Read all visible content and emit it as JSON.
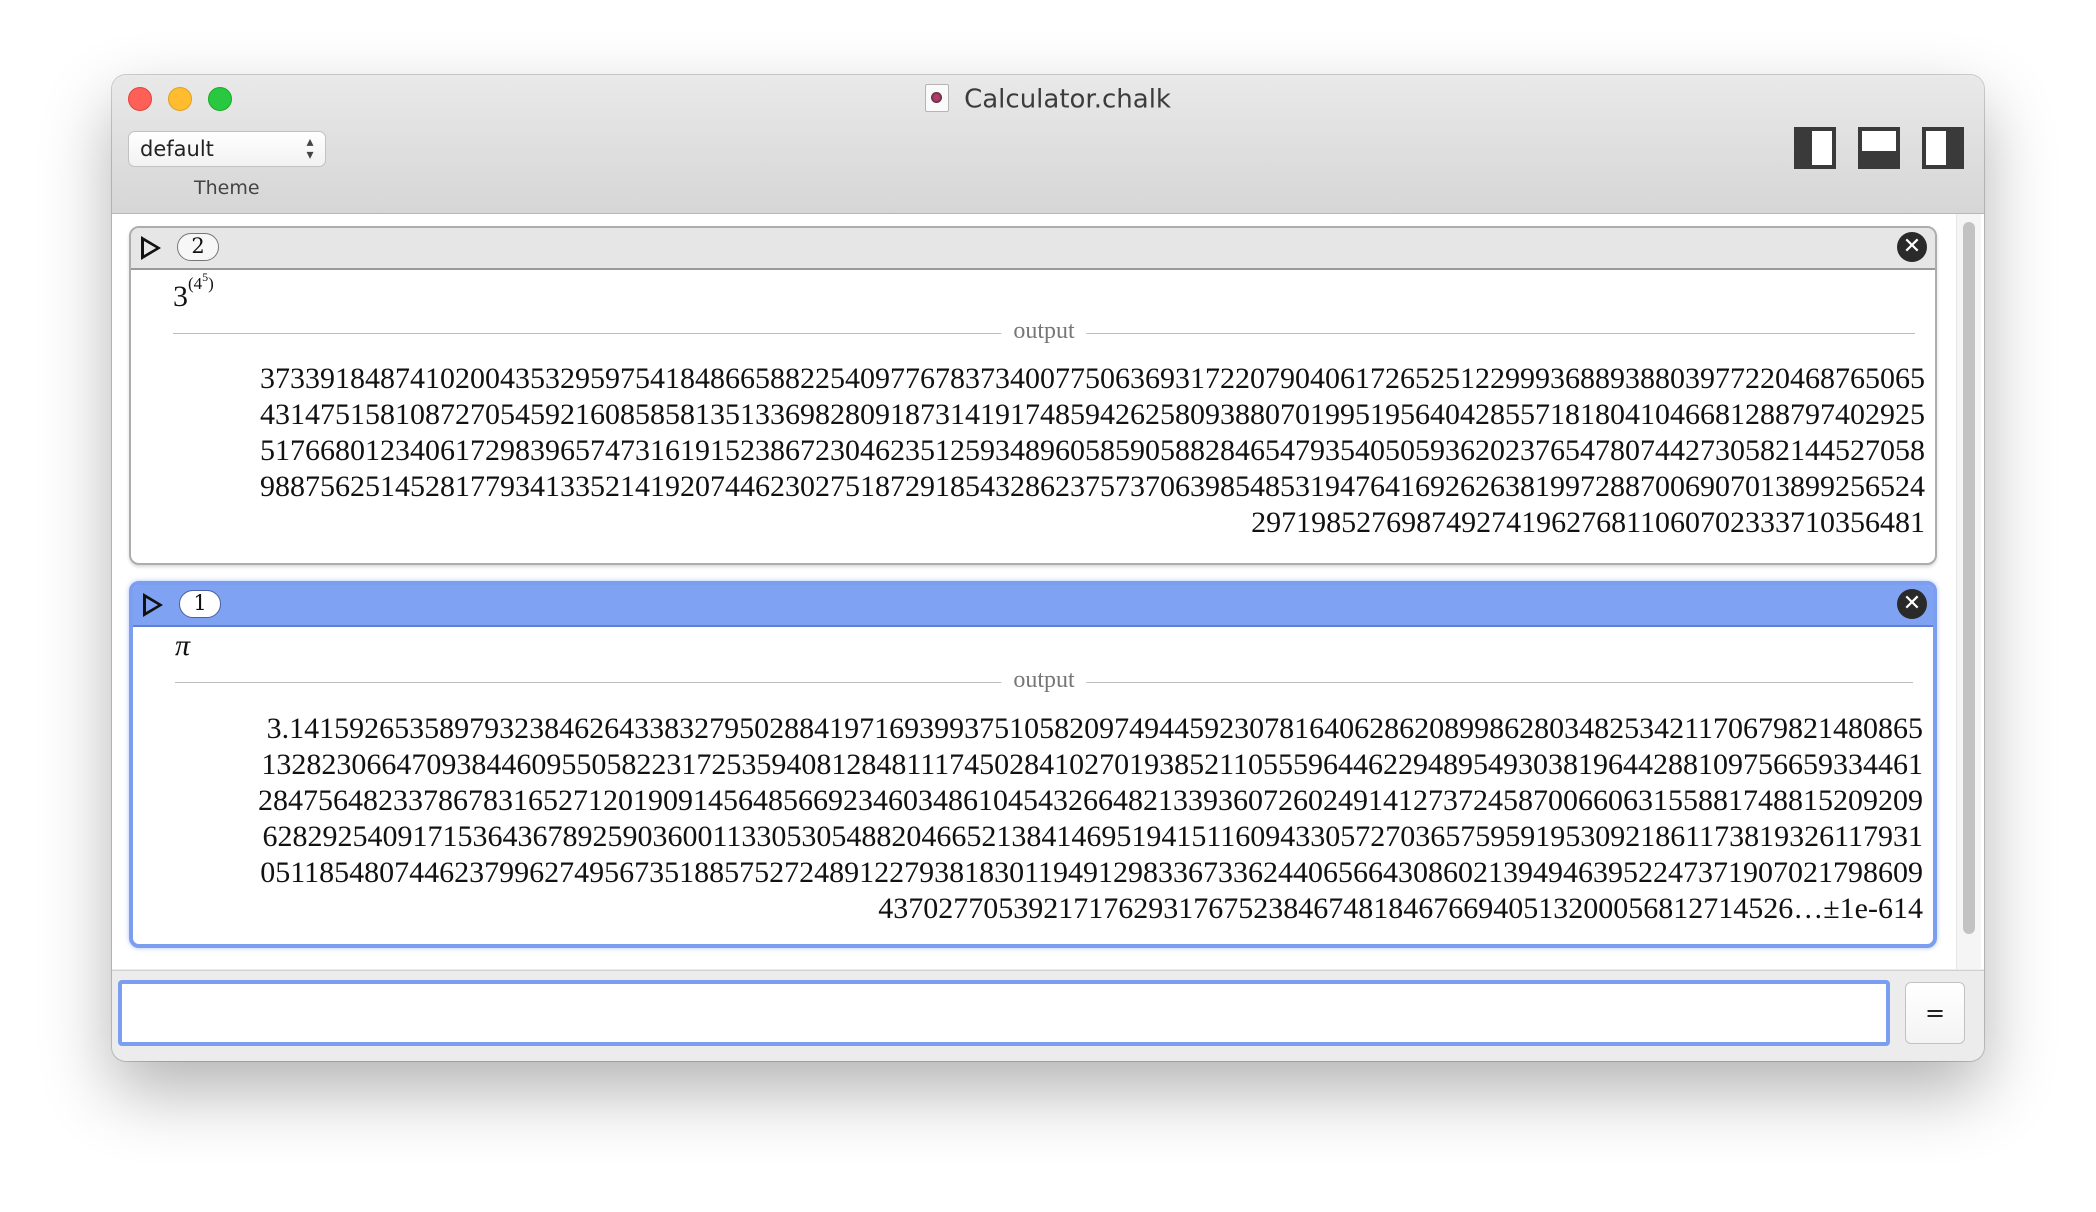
{
  "window": {
    "title": "Calculator.chalk"
  },
  "toolbar": {
    "theme_value": "default",
    "theme_label": "Theme"
  },
  "entries": [
    {
      "index": "2",
      "expression_base": "3",
      "expression_exp_open": "(4",
      "expression_exp_exp": "5",
      "expression_exp_close": ")",
      "output_label": "output",
      "result_lines": [
        "3733918487410200435329597541848665882254097767837340077506369317220790406172652512299936889388039772204687650 65",
        "431475158108727054592160858581351336982809187314191748594262580938807019951956404285571818041046681288797402925",
        "517668012340617298396574731619152386723046235125934896058590588284654793540505936202376547807442730582144527058",
        "988756251452817793413352141920744623027518729185432862375737063985485319476416926263819972887006907013899256524",
        "29719852769874927419627681106070233371035648 1"
      ]
    },
    {
      "index": "1",
      "expression": "π",
      "output_label": "output",
      "result_lines": [
        "3.14159265358979323846264338327950288419716939937510582097494459230781640628620899862803482534211706798214808 65",
        "132823066470938446095505822317253594081284811174502841027019385211055596446229489549303819644288109756659334461",
        "284756482337867831652712019091456485669234603486104543266482133936072602491412737245870066063155881748815209209",
        "628292540917153643678925903600113305305488204665213841469519415116094330572703657595919530921861173819326117931",
        "051185480744623799627495673518857527248912279381830119491298336733624406566430860213949463952247371907021798609",
        "4370277053921717629317675238467481846766940513200056812714526…±1e-614"
      ]
    }
  ],
  "input": {
    "value": "",
    "placeholder": ""
  },
  "eq_button_label": "="
}
